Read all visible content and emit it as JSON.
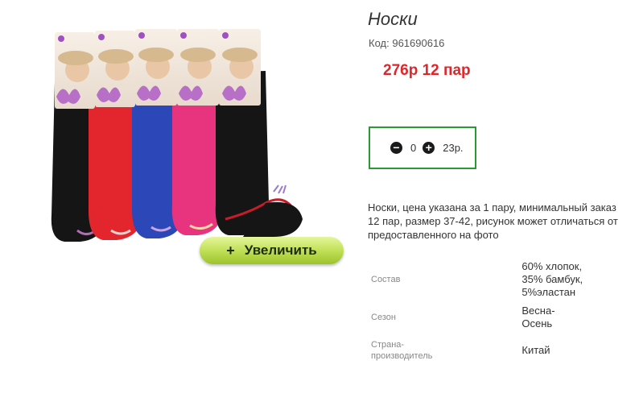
{
  "product": {
    "title": "Носки",
    "code_label": "Код:",
    "code": "961690616",
    "price_text": "276р 12 пар",
    "description": "Носки, цена указана за 1 пару, минимальный заказ 12 пар, размер 37-42, рисунок может отличаться от предоставленного на фото"
  },
  "quantity": {
    "decrement_icon": "minus-circle-icon",
    "increment_icon": "plus-circle-icon",
    "value": "0",
    "unit_price": "23р."
  },
  "zoom_button": {
    "plus": "+",
    "label": "Увеличить"
  },
  "specs": [
    {
      "label": "Состав",
      "value": "60% хлопок, 35% бамбук, 5%эластан"
    },
    {
      "label": "Сезон",
      "value": "Весна-Осень"
    },
    {
      "label": "Страна-производитель",
      "value": "Китай"
    }
  ],
  "colors": {
    "price": "#e0262b",
    "qty_border": "#2a9a37",
    "zoom_button": "#b5d94a",
    "sock_colors": [
      "#151515",
      "#e3262e",
      "#2b47b8",
      "#e8337e",
      "#151515"
    ]
  }
}
